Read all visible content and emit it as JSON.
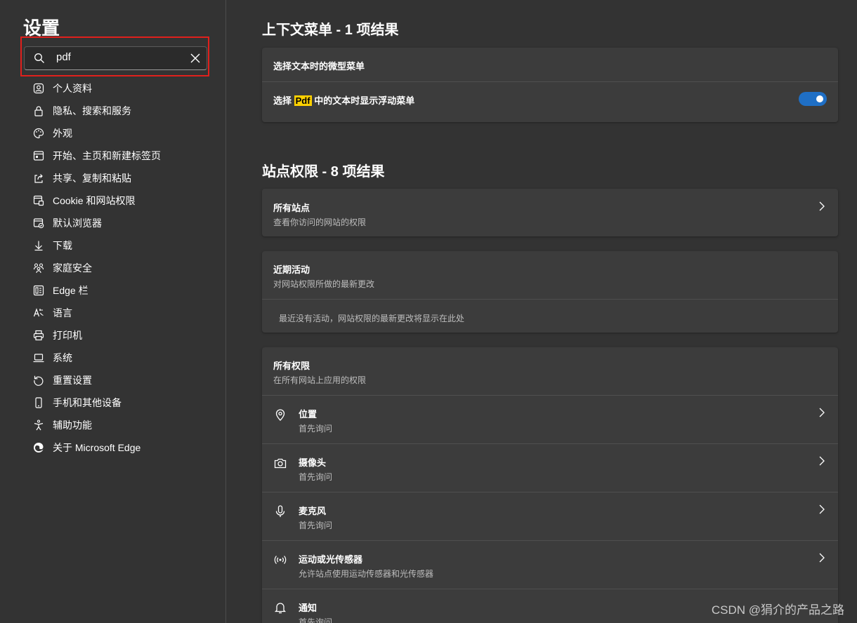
{
  "sidebar": {
    "title": "设置",
    "search": {
      "value": "pdf"
    },
    "items": [
      {
        "label": "个人资料",
        "icon": "profile-icon"
      },
      {
        "label": "隐私、搜索和服务",
        "icon": "lock-icon"
      },
      {
        "label": "外观",
        "icon": "palette-icon"
      },
      {
        "label": "开始、主页和新建标签页",
        "icon": "start-page-icon"
      },
      {
        "label": "共享、复制和粘贴",
        "icon": "share-icon"
      },
      {
        "label": "Cookie 和网站权限",
        "icon": "site-permissions-icon"
      },
      {
        "label": "默认浏览器",
        "icon": "default-browser-icon"
      },
      {
        "label": "下载",
        "icon": "download-icon"
      },
      {
        "label": "家庭安全",
        "icon": "family-icon"
      },
      {
        "label": "Edge 栏",
        "icon": "edge-bar-icon"
      },
      {
        "label": "语言",
        "icon": "language-icon"
      },
      {
        "label": "打印机",
        "icon": "printer-icon"
      },
      {
        "label": "系统",
        "icon": "system-icon"
      },
      {
        "label": "重置设置",
        "icon": "reset-icon"
      },
      {
        "label": "手机和其他设备",
        "icon": "phone-icon"
      },
      {
        "label": "辅助功能",
        "icon": "accessibility-icon"
      },
      {
        "label": "关于 Microsoft Edge",
        "icon": "edge-logo-icon"
      }
    ]
  },
  "context_menu_section": {
    "heading": "上下文菜单 - 1 项结果",
    "rows": [
      {
        "title": "选择文本时的微型菜单"
      },
      {
        "title_prefix": "选择 ",
        "title_highlight": "Pdf",
        "title_suffix": " 中的文本时显示浮动菜单",
        "toggle_on": true
      }
    ]
  },
  "site_permissions_section": {
    "heading": "站点权限 - 8 项结果",
    "all_sites": {
      "title": "所有站点",
      "subtitle": "查看你访问的网站的权限"
    },
    "recent_activity": {
      "title": "近期活动",
      "subtitle": "对网站权限所做的最新更改",
      "empty_text": "最近没有活动，网站权限的最新更改将显示在此处"
    },
    "all_permissions": {
      "title": "所有权限",
      "subtitle": "在所有网站上应用的权限",
      "items": [
        {
          "title": "位置",
          "subtitle": "首先询问",
          "icon": "location-icon"
        },
        {
          "title": "摄像头",
          "subtitle": "首先询问",
          "icon": "camera-icon"
        },
        {
          "title": "麦克风",
          "subtitle": "首先询问",
          "icon": "microphone-icon"
        },
        {
          "title": "运动或光传感器",
          "subtitle": "允许站点使用运动传感器和光传感器",
          "icon": "sensor-icon"
        },
        {
          "title": "通知",
          "subtitle": "首先询问",
          "icon": "bell-icon"
        }
      ]
    }
  },
  "watermark": "CSDN @狷介的产品之路",
  "colors": {
    "accent": "#1f6fc5",
    "highlight": "#ffd100",
    "annotation_box": "#e0201c"
  }
}
